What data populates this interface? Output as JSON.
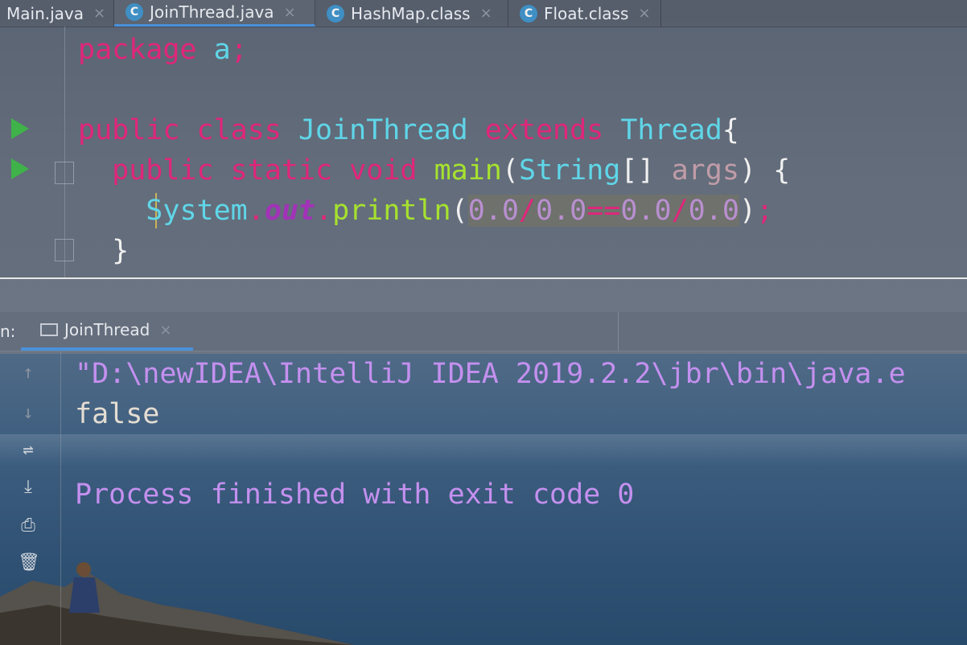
{
  "tabs": [
    {
      "label": "Main.java",
      "icon": "none",
      "active": false
    },
    {
      "label": "JoinThread.java",
      "icon": "class-icon",
      "active": true
    },
    {
      "label": "HashMap.class",
      "icon": "class-icon",
      "active": false
    },
    {
      "label": "Float.class",
      "icon": "class-icon",
      "active": false
    }
  ],
  "tab_close_glyph": "×",
  "class_icon_letter": "C",
  "code": {
    "line1": {
      "kw": "package",
      "pkg": "a",
      "semi": ";"
    },
    "line3": {
      "public": "public",
      "class": "class",
      "name": "JoinThread",
      "extends": "extends",
      "super": "Thread",
      "brace": "{"
    },
    "line4": {
      "public": "public",
      "static": "static",
      "void": "void",
      "method": "main",
      "lparen": "(",
      "type": "String",
      "arr": "[]",
      "param": "args",
      "rparen": ")",
      "brace": "{"
    },
    "line5": {
      "system": "System",
      "dot1": ".",
      "field": "out",
      "dot2": ".",
      "method": "println",
      "lparen": "(",
      "n1": "0.0",
      "div1": "/",
      "n2": "0.0",
      "eq": "==",
      "n3": "0.0",
      "div2": "/",
      "n4": "0.0",
      "rparen": ")",
      "semi": ";"
    },
    "line6": {
      "brace": "}"
    }
  },
  "run_panel": {
    "label": "n:",
    "tab_label": "JoinThread",
    "output": [
      "\"D:\\newIDEA\\IntelliJ IDEA 2019.2.2\\jbr\\bin\\java.e",
      "false",
      "",
      "Process finished with exit code 0"
    ]
  },
  "colors": {
    "accent": "#4a90d9",
    "run_arrow": "#3fb34a",
    "keyword": "#e0267a",
    "class": "#5fd6e8",
    "output_purple": "#c490ef"
  }
}
